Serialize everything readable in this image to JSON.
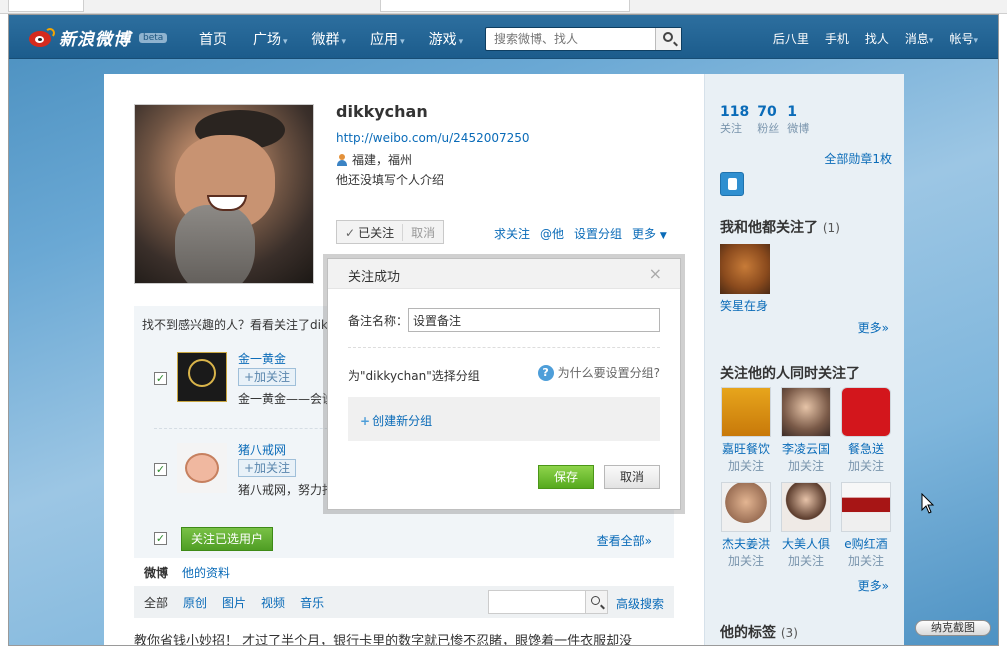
{
  "nav": {
    "logo_text": "新浪微博",
    "beta": "beta",
    "items": [
      {
        "label": "首页",
        "caret": ""
      },
      {
        "label": "广场",
        "caret": "▾"
      },
      {
        "label": "微群",
        "caret": "▾"
      },
      {
        "label": "应用",
        "caret": "▾"
      },
      {
        "label": "游戏",
        "caret": "▾"
      }
    ],
    "search_placeholder": "搜索微博、找人",
    "right": [
      "后八里",
      "手机",
      "找人",
      "消息",
      "帐号"
    ],
    "right_caret": "▾"
  },
  "profile": {
    "name": "dikkychan",
    "url": "http://weibo.com/u/2452007250",
    "location": "福建，福州",
    "bio": "他还没填写个人介绍",
    "follow_done": "已关注",
    "follow_cancel": "取消",
    "actions": [
      "求关注",
      "@他",
      "设置分组",
      "更多"
    ],
    "more_caret": "▼"
  },
  "suggest": {
    "title": "找不到感兴趣的人？看看关注了dik",
    "add_label": "+加关注",
    "check": "✓",
    "users": [
      {
        "name": "金一黄金",
        "desc": "金一黄金——会说"
      },
      {
        "name": "猪八戒网",
        "desc": "猪八戒网，努力打"
      }
    ],
    "follow_selected": "关注已选用户",
    "view_all": "查看全部»"
  },
  "feed": {
    "tabs": [
      "微博",
      "他的资料"
    ],
    "filters": [
      "全部",
      "原创",
      "图片",
      "视频",
      "音乐"
    ],
    "advanced_search": "高级搜索",
    "first_post": "教你省钱小妙招！ 才过了半个月，银行卡里的数字就已惨不忍睹，眼馋着一件衣服却没"
  },
  "sidebar": {
    "stats": [
      {
        "num": "118",
        "label": "关注"
      },
      {
        "num": "70",
        "label": "粉丝"
      },
      {
        "num": "1",
        "label": "微博"
      }
    ],
    "badges_link": "全部勋章1枚",
    "mutual_title": "我和他都关注了",
    "mutual_count": "(1)",
    "mutual_user": "笑星在身",
    "more_label": "更多»",
    "also_title": "关注他的人同时关注了",
    "also_follow_label": "加关注",
    "also_users": [
      "嘉旺餐饮",
      "李凌云国",
      "餐急送",
      "杰夫姜洪",
      "大美人俱",
      "e购红酒"
    ],
    "tags_title": "他的标签",
    "tags_count": "(3)"
  },
  "dialog": {
    "title": "关注成功",
    "close": "×",
    "remark_label": "备注名称：",
    "remark_value": "设置备注",
    "group_prompt": "为\"dikkychan\"选择分组",
    "why_help": "为什么要设置分组?",
    "help_glyph": "?",
    "create_group": "创建新分组",
    "save": "保存",
    "cancel": "取消"
  },
  "tool": {
    "snip": "纳克截图"
  },
  "colors": {
    "nav_bg": "#1c5c8c",
    "link": "#0a6bb8",
    "save_green": "#56a91e"
  }
}
